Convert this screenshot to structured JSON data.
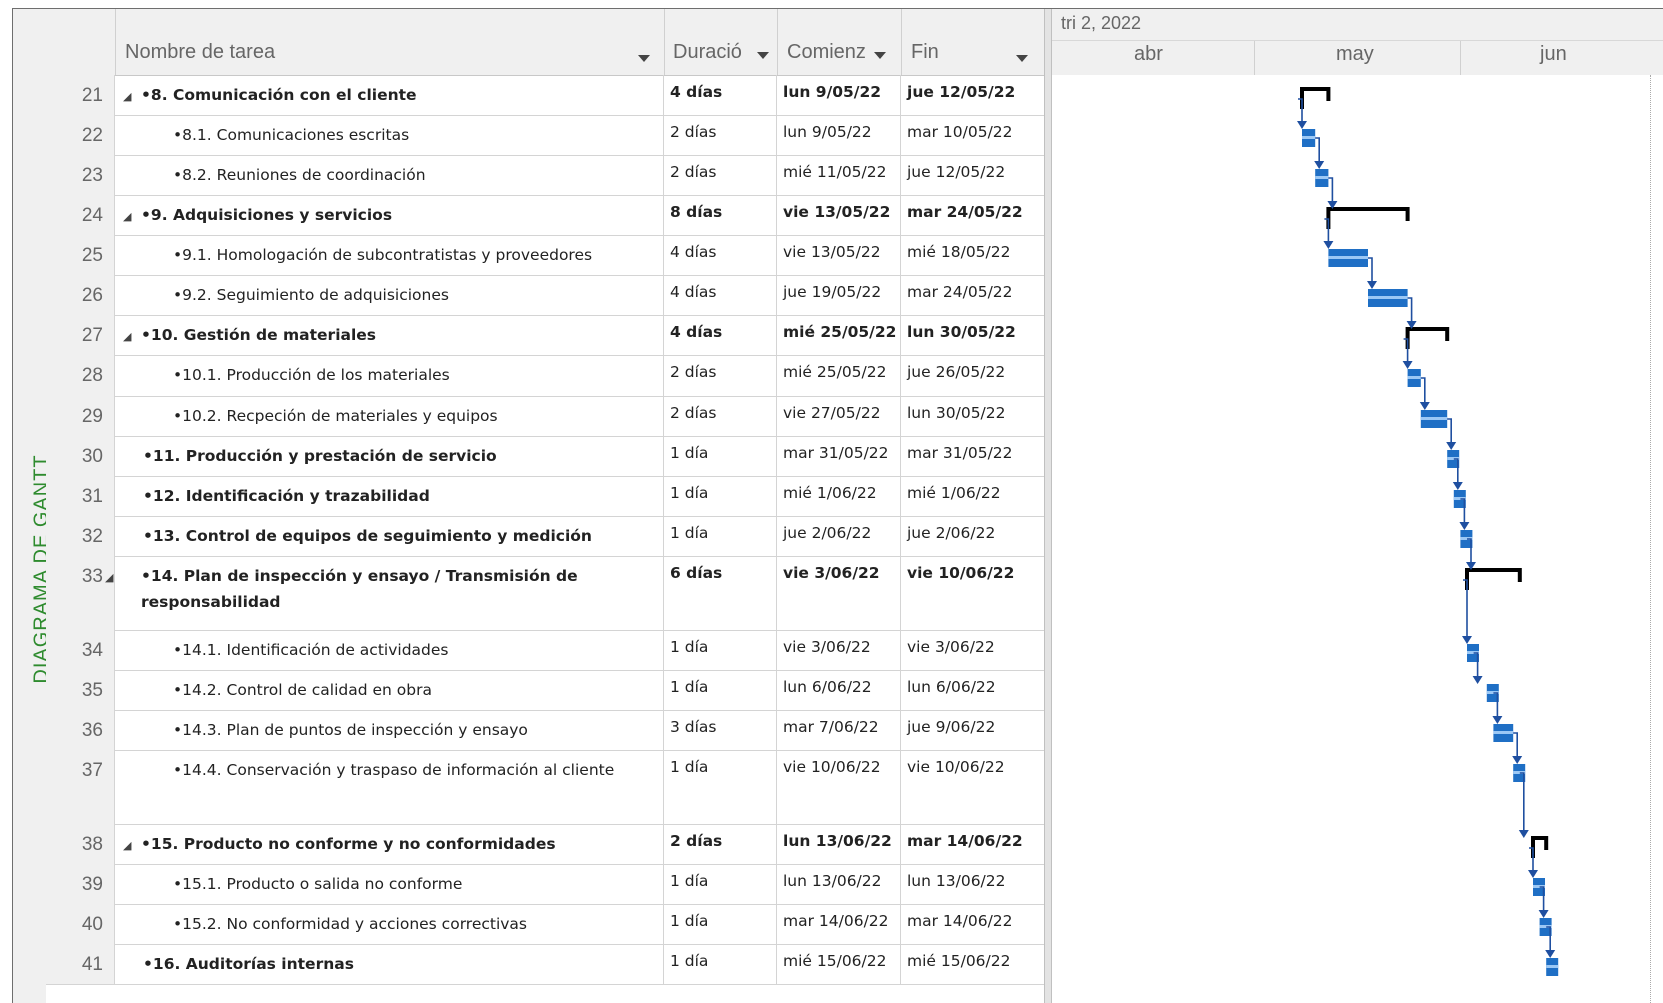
{
  "side_label": "DIAGRAMA DE GANTT",
  "columns": {
    "name": "Nombre de tarea",
    "duration": "Duració",
    "start": "Comienz",
    "end": "Fin"
  },
  "timescale": {
    "top_tier": "tri 2, 2022",
    "months": [
      "abr",
      "may",
      "jun"
    ]
  },
  "colors": {
    "accent": "#2e8b2e",
    "bar": "#1f6fc5",
    "summary": "#000000",
    "link": "#1f4fa0"
  },
  "rows": [
    {
      "id": "21",
      "name": "•8. Comunicación con el cliente",
      "duration": "4 días",
      "start": "lun 9/05/22",
      "end": "jue 12/05/22",
      "summary": true,
      "level": 0
    },
    {
      "id": "22",
      "name": "•8.1. Comunicaciones escritas",
      "duration": "2 días",
      "start": "lun 9/05/22",
      "end": "mar 10/05/22",
      "summary": false,
      "level": 1
    },
    {
      "id": "23",
      "name": "•8.2. Reuniones de coordinación",
      "duration": "2 días",
      "start": "mié 11/05/22",
      "end": "jue 12/05/22",
      "summary": false,
      "level": 1
    },
    {
      "id": "24",
      "name": "•9. Adquisiciones y servicios",
      "duration": "8 días",
      "start": "vie 13/05/22",
      "end": "mar 24/05/22",
      "summary": true,
      "level": 0
    },
    {
      "id": "25",
      "name": "•9.1. Homologación de subcontratistas y proveedores",
      "duration": "4 días",
      "start": "vie 13/05/22",
      "end": "mié 18/05/22",
      "summary": false,
      "level": 1
    },
    {
      "id": "26",
      "name": "•9.2. Seguimiento de adquisiciones",
      "duration": "4 días",
      "start": "jue 19/05/22",
      "end": "mar 24/05/22",
      "summary": false,
      "level": 1
    },
    {
      "id": "27",
      "name": "•10. Gestión de materiales",
      "duration": "4 días",
      "start": "mié 25/05/22",
      "end": "lun 30/05/22",
      "summary": true,
      "level": 0
    },
    {
      "id": "28",
      "name": "•10.1. Producción de los materiales",
      "duration": "2 días",
      "start": "mié 25/05/22",
      "end": "jue 26/05/22",
      "summary": false,
      "level": 1
    },
    {
      "id": "29",
      "name": "•10.2. Recpeción de materiales y equipos",
      "duration": "2 días",
      "start": "vie 27/05/22",
      "end": "lun 30/05/22",
      "summary": false,
      "level": 1
    },
    {
      "id": "30",
      "name": "•11. Producción y prestación de servicio",
      "duration": "1 día",
      "start": "mar 31/05/22",
      "end": "mar 31/05/22",
      "summary": false,
      "level": 0,
      "boldname": true
    },
    {
      "id": "31",
      "name": "•12. Identificación y trazabilidad",
      "duration": "1 día",
      "start": "mié 1/06/22",
      "end": "mié 1/06/22",
      "summary": false,
      "level": 0,
      "boldname": true
    },
    {
      "id": "32",
      "name": "•13. Control de equipos de seguimiento y medición",
      "duration": "1 día",
      "start": "jue 2/06/22",
      "end": "jue 2/06/22",
      "summary": false,
      "level": 0,
      "boldname": true
    },
    {
      "id": "33",
      "name": "•14. Plan de inspección y ensayo / Transmisión de responsabilidad",
      "duration": "6 días",
      "start": "vie 3/06/22",
      "end": "vie 10/06/22",
      "summary": true,
      "level": 0,
      "tall": true
    },
    {
      "id": "34",
      "name": "•14.1. Identificación de actividades",
      "duration": "1 día",
      "start": "vie 3/06/22",
      "end": "vie 3/06/22",
      "summary": false,
      "level": 1
    },
    {
      "id": "35",
      "name": "•14.2. Control de calidad en obra",
      "duration": "1 día",
      "start": "lun 6/06/22",
      "end": "lun 6/06/22",
      "summary": false,
      "level": 1
    },
    {
      "id": "36",
      "name": "•14.3. Plan de puntos de inspección y ensayo",
      "duration": "3 días",
      "start": "mar 7/06/22",
      "end": "jue 9/06/22",
      "summary": false,
      "level": 1
    },
    {
      "id": "37",
      "name": "•14.4. Conservación y traspaso de información al cliente",
      "duration": "1 día",
      "start": "vie 10/06/22",
      "end": "vie 10/06/22",
      "summary": false,
      "level": 1,
      "tall": true
    },
    {
      "id": "38",
      "name": "•15. Producto no conforme y no conformidades",
      "duration": "2 días",
      "start": "lun 13/06/22",
      "end": "mar 14/06/22",
      "summary": true,
      "level": 0
    },
    {
      "id": "39",
      "name": "•15.1. Producto o salida no conforme",
      "duration": "1 día",
      "start": "lun 13/06/22",
      "end": "lun 13/06/22",
      "summary": false,
      "level": 1
    },
    {
      "id": "40",
      "name": "•15.2. No conformidad y acciones correctivas",
      "duration": "1 día",
      "start": "mar 14/06/22",
      "end": "mar 14/06/22",
      "summary": false,
      "level": 1
    },
    {
      "id": "41",
      "name": "•16. Auditorías internas",
      "duration": "1 día",
      "start": "mié 15/06/22",
      "end": "mié 15/06/22",
      "summary": false,
      "level": 0,
      "boldname": true
    }
  ]
}
